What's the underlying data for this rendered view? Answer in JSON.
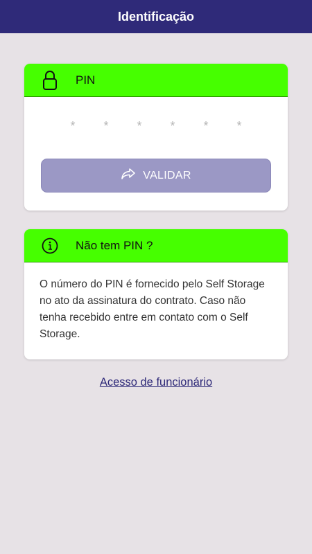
{
  "header": {
    "title": "Identificação"
  },
  "pin_card": {
    "icon": "lock-icon",
    "title": "PIN",
    "pin_placeholder": "* * * * * *",
    "validate_label": "VALIDAR",
    "validate_icon": "share-arrow-icon"
  },
  "info_card": {
    "icon": "info-icon",
    "title": "Não tem PIN ?",
    "text": "O número do PIN é fornecido pelo Self Storage no ato da assinatura do contrato. Caso não tenha recebido entre em contato com o Self Storage."
  },
  "employee_link": {
    "label": "Acesso de funcionário"
  },
  "colors": {
    "app_bar": "#2f2a79",
    "card_header": "#46ff00",
    "button": "#9b98c5",
    "background": "#e7e2e6"
  }
}
